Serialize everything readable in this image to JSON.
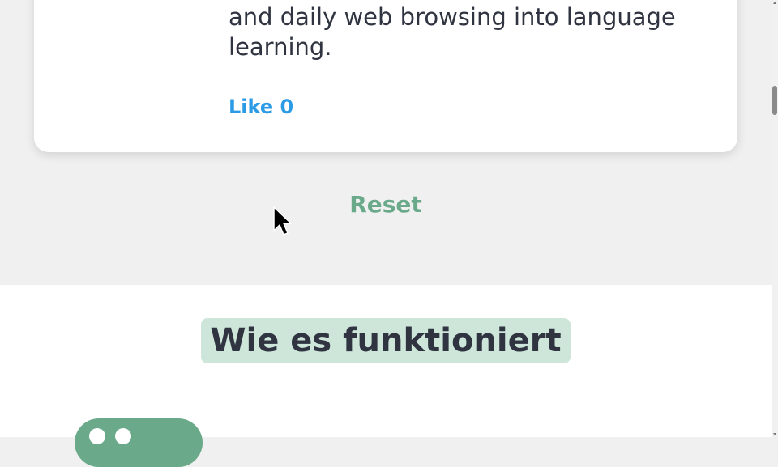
{
  "card": {
    "description": "Turn aimless social media procrastination and daily web browsing into language learning.",
    "like_label": "Like 0"
  },
  "reset_label": "Reset",
  "how_it_works": {
    "title": "Wie es funktioniert"
  },
  "colors": {
    "accent_green": "#6aaa8a",
    "title_highlight": "#cde6d9",
    "link_blue": "#2b9be5",
    "text_dark": "#2f3440"
  },
  "icons": {
    "cursor": "mouse-cursor-icon",
    "chat": "chat-bubble-icon"
  }
}
